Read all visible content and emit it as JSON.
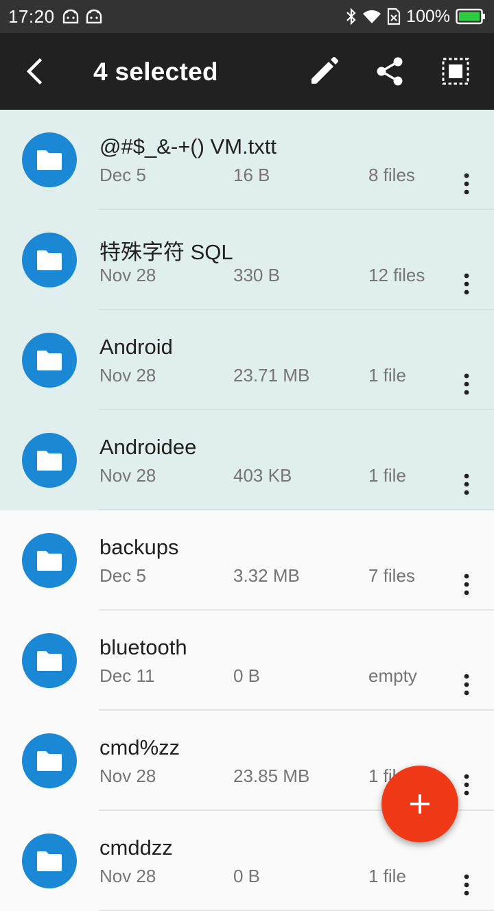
{
  "status_bar": {
    "time": "17:20",
    "battery": "100%",
    "icons": [
      "android-debug-icon",
      "android-debug-icon",
      "bluetooth-icon",
      "wifi-icon",
      "sim-off-icon",
      "battery-icon"
    ]
  },
  "toolbar": {
    "title": "4 selected",
    "actions": [
      "back-icon",
      "edit-icon",
      "share-icon",
      "select-all-icon"
    ]
  },
  "files": [
    {
      "name": "@#$_&-+() VM.txtt",
      "date": "Dec 5",
      "size": "16 B",
      "count": "8 files",
      "selected": true
    },
    {
      "name": "特殊字符 SQL",
      "date": "Nov 28",
      "size": "330 B",
      "count": "12 files",
      "selected": true
    },
    {
      "name": "Android",
      "date": "Nov 28",
      "size": "23.71 MB",
      "count": "1 file",
      "selected": true
    },
    {
      "name": "Androidee",
      "date": "Nov 28",
      "size": "403 KB",
      "count": "1 file",
      "selected": true
    },
    {
      "name": "backups",
      "date": "Dec 5",
      "size": "3.32 MB",
      "count": "7 files",
      "selected": false
    },
    {
      "name": "bluetooth",
      "date": "Dec 11",
      "size": "0 B",
      "count": "empty",
      "selected": false
    },
    {
      "name": "cmd%zz",
      "date": "Nov 28",
      "size": "23.85 MB",
      "count": "1 file",
      "selected": false
    },
    {
      "name": "cmddzz",
      "date": "Nov 28",
      "size": "0 B",
      "count": "1 file",
      "selected": false
    }
  ],
  "fab": {
    "icon": "add-icon"
  },
  "colors": {
    "toolbar": "#212121",
    "status_bar": "#333333",
    "selected_row": "#e0eeee",
    "folder_icon": "#1a88d4",
    "fab": "#f03a17",
    "battery": "#2ecc40"
  }
}
